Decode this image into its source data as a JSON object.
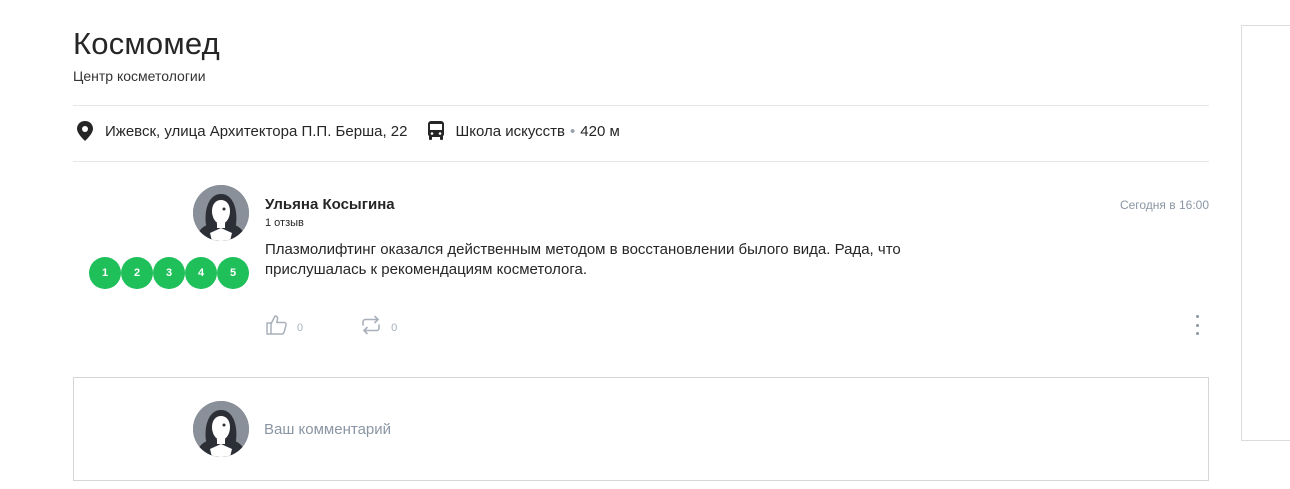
{
  "org": {
    "name": "Космомед",
    "category": "Центр косметологии"
  },
  "location": {
    "address": "Ижевск, улица Архитектора П.П. Берша, 22",
    "stop_name": "Школа искусств",
    "separator": "•",
    "distance": "420 м",
    "icons": [
      "map-pin-icon",
      "bus-icon"
    ]
  },
  "review": {
    "author": "Ульяна Косыгина",
    "review_count": "1 отзыв",
    "date": "Сегодня в 16:00",
    "text": "Плазмолифтинг оказался действенным методом в восстановлении былого вида. Рада, что прислушалась к рекомендациям косметолога.",
    "ratings": [
      "1",
      "2",
      "3",
      "4",
      "5"
    ],
    "likes": "0",
    "reposts": "0",
    "icons": [
      "like-icon",
      "repost-icon",
      "more-icon"
    ]
  },
  "comment": {
    "placeholder": "Ваш комментарий"
  },
  "colors": {
    "rating_green": "#1fbf59",
    "muted": "#8a96a3",
    "text": "#262626"
  }
}
